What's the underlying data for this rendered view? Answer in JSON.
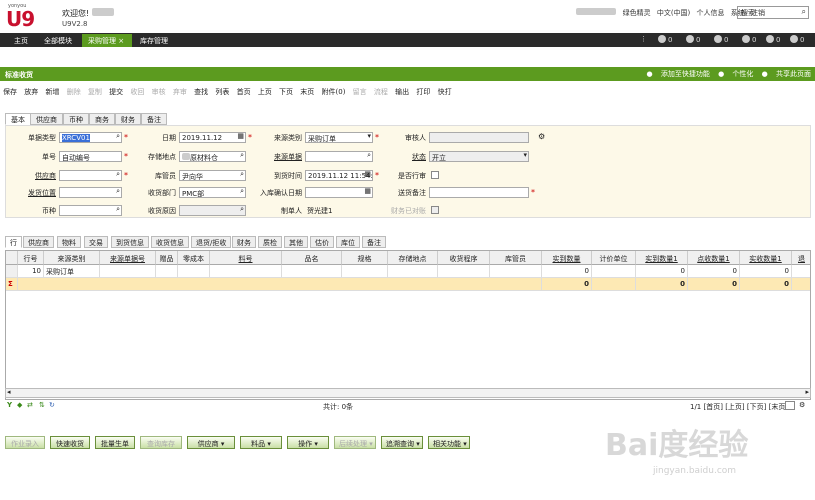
{
  "app": {
    "brand_small": "yonyou",
    "brand": "U9",
    "welcome": "欢迎您!",
    "version": "U9V2.8"
  },
  "top_links": [
    "绿色精灵",
    "中文(中国)",
    "个人信息",
    "系统",
    "注销"
  ],
  "top_search": {
    "placeholder": "搜索",
    "icon": "search-icon"
  },
  "main_tabs": [
    {
      "label": "主页",
      "active": false
    },
    {
      "label": "全部模块",
      "active": false
    },
    {
      "label": "采购管理",
      "active": true,
      "close": "×"
    },
    {
      "label": "库存管理",
      "active": false
    }
  ],
  "status_counts": [
    "0",
    "0",
    "0",
    "0",
    "0",
    "0"
  ],
  "page": {
    "title": "标准收货",
    "header_links": [
      "添加至快捷功能",
      "个性化",
      "共享此页面"
    ]
  },
  "toolbar": [
    {
      "label": "保存",
      "enabled": true
    },
    {
      "label": "放弃",
      "enabled": true
    },
    {
      "label": "新增",
      "enabled": true
    },
    {
      "label": "删除",
      "enabled": false
    },
    {
      "label": "复制",
      "enabled": false
    },
    {
      "label": "提交",
      "enabled": true
    },
    {
      "label": "收回",
      "enabled": false
    },
    {
      "label": "审核",
      "enabled": false
    },
    {
      "label": "弃审",
      "enabled": false
    },
    {
      "label": "查找",
      "enabled": true
    },
    {
      "label": "列表",
      "enabled": true
    },
    {
      "label": "首页",
      "enabled": true
    },
    {
      "label": "上页",
      "enabled": true
    },
    {
      "label": "下页",
      "enabled": true
    },
    {
      "label": "末页",
      "enabled": true
    },
    {
      "label": "附件(0)",
      "enabled": true
    },
    {
      "label": "留言",
      "enabled": false
    },
    {
      "label": "流程",
      "enabled": false
    },
    {
      "label": "输出",
      "enabled": true
    },
    {
      "label": "打印",
      "enabled": true
    },
    {
      "label": "快打",
      "enabled": true
    }
  ],
  "form_tabs": [
    {
      "label": "基本",
      "active": true
    },
    {
      "label": "供应商",
      "active": false
    },
    {
      "label": "币种",
      "active": false
    },
    {
      "label": "商务",
      "active": false
    },
    {
      "label": "财务",
      "active": false
    },
    {
      "label": "备注",
      "active": false
    }
  ],
  "form": {
    "doc_type": {
      "label": "单据类型",
      "value": "XRCV01"
    },
    "doc_no": {
      "label": "单号",
      "value": "自动编号"
    },
    "supplier": {
      "label": "供应商",
      "value": ""
    },
    "ship_location": {
      "label": "发货位置",
      "value": ""
    },
    "currency": {
      "label": "币种",
      "value": ""
    },
    "date": {
      "label": "日期",
      "value": "2019.11.12"
    },
    "storage_location": {
      "label": "存储地点",
      "value": "原材料仓"
    },
    "storekeeper": {
      "label": "库管员",
      "value": "尹向华"
    },
    "receiving_dept": {
      "label": "收货部门",
      "value": "PMC部"
    },
    "receiving_reason": {
      "label": "收货原因",
      "value": ""
    },
    "source_type": {
      "label": "来源类别",
      "value": "采购订单"
    },
    "source_doc": {
      "label": "来源单据",
      "value": ""
    },
    "arrival_time": {
      "label": "到货时间",
      "value": "2019.11.12 11:54:11"
    },
    "inbound_confirm_date": {
      "label": "入库确认日期",
      "value": ""
    },
    "creator": {
      "label": "制单人",
      "value": "贺光建1"
    },
    "reviewer": {
      "label": "审核人",
      "value": ""
    },
    "status": {
      "label": "状态",
      "value": "开立"
    },
    "is_rework": {
      "label": "是否行审"
    },
    "delivery_note": {
      "label": "送货备注",
      "value": ""
    },
    "finance_closed": {
      "label": "财务已对账"
    }
  },
  "grid_tabs": [
    {
      "label": "行",
      "active": true
    },
    {
      "label": "供应商",
      "active": false
    },
    {
      "label": "物料",
      "active": false
    },
    {
      "label": "交易",
      "active": false
    },
    {
      "label": "到货信息",
      "active": false
    },
    {
      "label": "收货信息",
      "active": false
    },
    {
      "label": "退货/拒收",
      "active": false
    },
    {
      "label": "财务",
      "active": false
    },
    {
      "label": "质检",
      "active": false
    },
    {
      "label": "其他",
      "active": false
    },
    {
      "label": "估价",
      "active": false
    },
    {
      "label": "库位",
      "active": false
    },
    {
      "label": "备注",
      "active": false
    }
  ],
  "grid": {
    "columns": [
      "行号",
      "来源类别",
      "来源单据号",
      "赠品",
      "零成本",
      "料号",
      "品名",
      "规格",
      "存储地点",
      "收货程序",
      "库管员",
      "实到数量",
      "计价单位",
      "实到数量1",
      "点收数量1",
      "实收数量1",
      "退"
    ],
    "rows": [
      [
        "10",
        "采购订单",
        "",
        "",
        "",
        "",
        "",
        "",
        "",
        "",
        "",
        "0",
        "",
        "0",
        "0",
        "0",
        ""
      ]
    ],
    "sum_row": [
      "",
      "",
      "",
      "",
      "",
      "",
      "",
      "",
      "",
      "",
      "",
      "0",
      "",
      "0",
      "0",
      "0",
      ""
    ],
    "sum_icon": "Σ",
    "total_text": "共计: 0条",
    "pager": [
      "1/1",
      "[首页]",
      "[上页]",
      "[下页]",
      "[末页]"
    ]
  },
  "bottom_buttons": [
    {
      "label": "作业录入",
      "enabled": false,
      "dropdown": false
    },
    {
      "label": "快速收货",
      "enabled": true,
      "dropdown": false
    },
    {
      "label": "批量生单",
      "enabled": true,
      "dropdown": false
    },
    {
      "label": "查询库存",
      "enabled": false,
      "dropdown": false
    },
    {
      "label": "供应商",
      "enabled": true,
      "dropdown": true
    },
    {
      "label": "料品",
      "enabled": true,
      "dropdown": true
    },
    {
      "label": "操作",
      "enabled": true,
      "dropdown": true
    },
    {
      "label": "后续处理",
      "enabled": false,
      "dropdown": true
    },
    {
      "label": "追溯查询",
      "enabled": true,
      "dropdown": true
    },
    {
      "label": "相关功能",
      "enabled": true,
      "dropdown": true
    }
  ],
  "watermark": {
    "big": "Bai度经验",
    "small": "jingyan.baidu.com"
  }
}
